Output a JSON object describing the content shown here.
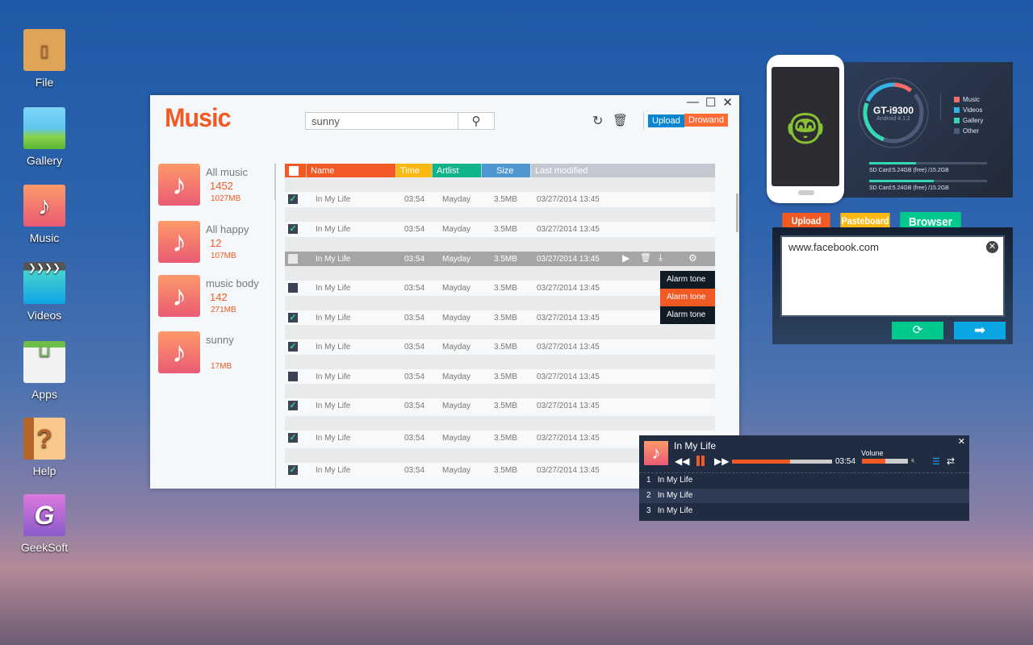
{
  "desktop": {
    "icons": [
      {
        "label": "File",
        "icon": "archive-icon"
      },
      {
        "label": "Gallery",
        "icon": "gallery-icon"
      },
      {
        "label": "Music",
        "icon": "music-icon"
      },
      {
        "label": "Videos",
        "icon": "video-icon"
      },
      {
        "label": "Apps",
        "icon": "apps-icon"
      },
      {
        "label": "Help",
        "icon": "help-icon"
      },
      {
        "label": "GeekSoft",
        "icon": "geeksoft-icon"
      }
    ]
  },
  "music": {
    "title": "Music",
    "search": "sunny",
    "upload": "Upload",
    "download": "Drowand",
    "sidebar": [
      {
        "title": "All music",
        "count": "1452",
        "size": "1027MB"
      },
      {
        "title": "All happy",
        "count": "12",
        "size": "107MB"
      },
      {
        "title": "music body",
        "count": "142",
        "size": "271MB"
      },
      {
        "title": "sunny",
        "count": "",
        "size": "17MB"
      }
    ],
    "columns": [
      "Name",
      "Time",
      "Artlist",
      "Size",
      "Last modified"
    ],
    "rows": [
      {
        "name": "In My Life",
        "time": "03:54",
        "artist": "Mayday",
        "size": "3.5MB",
        "modified": "03/27/2014 13:45",
        "checked": true
      },
      {
        "name": "In My Life",
        "time": "03:54",
        "artist": "Mayday",
        "size": "3.5MB",
        "modified": "03/27/2014 13:45",
        "checked": true
      },
      {
        "name": "In My Life",
        "time": "03:54",
        "artist": "Mayday",
        "size": "3.5MB",
        "modified": "03/27/2014 13:45",
        "checked": false,
        "selected": true
      },
      {
        "name": "In My Life",
        "time": "03:54",
        "artist": "Mayday",
        "size": "3.5MB",
        "modified": "03/27/2014 13:45",
        "checked": false
      },
      {
        "name": "In My Life",
        "time": "03:54",
        "artist": "Mayday",
        "size": "3.5MB",
        "modified": "03/27/2014 13:45",
        "checked": true
      },
      {
        "name": "In My Life",
        "time": "03:54",
        "artist": "Mayday",
        "size": "3.5MB",
        "modified": "03/27/2014 13:45",
        "checked": true
      },
      {
        "name": "In My Life",
        "time": "03:54",
        "artist": "Mayday",
        "size": "3.5MB",
        "modified": "03/27/2014 13:45",
        "checked": false
      },
      {
        "name": "In My Life",
        "time": "03:54",
        "artist": "Mayday",
        "size": "3.5MB",
        "modified": "03/27/2014 13:45",
        "checked": true
      },
      {
        "name": "In My Life",
        "time": "03:54",
        "artist": "Mayday",
        "size": "3.5MB",
        "modified": "03/27/2014 13:45",
        "checked": true
      },
      {
        "name": "In My Life",
        "time": "03:54",
        "artist": "Mayday",
        "size": "3.5MB",
        "modified": "03/27/2014 13:45",
        "checked": true
      }
    ],
    "context_menu": [
      "Alarm tone",
      "Alarm tone",
      "Alarm tone"
    ],
    "context_active": 1
  },
  "device": {
    "model": "GT-i9300",
    "os": "Android 4.1.2",
    "legend": [
      {
        "label": "Music",
        "color": "#f26b6b"
      },
      {
        "label": "Videos",
        "color": "#35b3e3"
      },
      {
        "label": "Gallery",
        "color": "#36d6b0"
      },
      {
        "label": "Other",
        "color": "#4a5a78"
      }
    ],
    "storage": [
      {
        "text": "SD Card:5.24GB (free) /15.2GB",
        "fill": 0.4
      },
      {
        "text": "SD Card:5.24GB (free) /15.2GB",
        "fill": 0.55
      }
    ]
  },
  "panel": {
    "tabs": [
      "Upload",
      "Pasteboard",
      "Browser"
    ],
    "url": "www.facebook.com"
  },
  "player": {
    "title": "In My Life",
    "time": "03:54",
    "volume_label": "Volune",
    "progress": 0.58,
    "volume": 0.5,
    "playlist": [
      {
        "n": "1",
        "title": "In My Life"
      },
      {
        "n": "2",
        "title": "In My Life"
      },
      {
        "n": "3",
        "title": "In My Life"
      }
    ]
  }
}
